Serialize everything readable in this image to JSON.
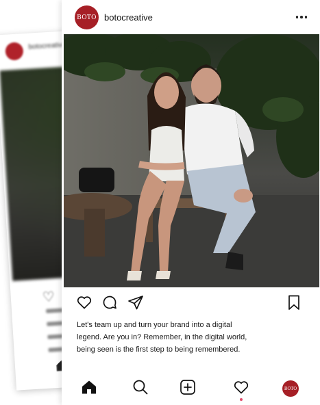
{
  "background_post": {
    "username": "botocreative"
  },
  "post": {
    "avatar_text": "BOTO",
    "username": "botocreative",
    "more_icon": "more-horizontal-icon",
    "caption_lines": [
      "Let's team up and turn your brand into a digital",
      "legend. Are you in? Remember, in the digital world,",
      "being seen is the first step to being remembered."
    ],
    "actions": [
      "heart-icon",
      "comment-icon",
      "share-icon",
      "bookmark-icon"
    ]
  },
  "bottom_nav": {
    "items": [
      "home-icon",
      "search-icon",
      "add-post-icon",
      "activity-heart-icon",
      "profile-avatar"
    ],
    "avatar_text": "BOTO",
    "notification_color": "#e04b6a"
  },
  "colors": {
    "brand": "#a61f26",
    "text": "#1a1a1a"
  }
}
